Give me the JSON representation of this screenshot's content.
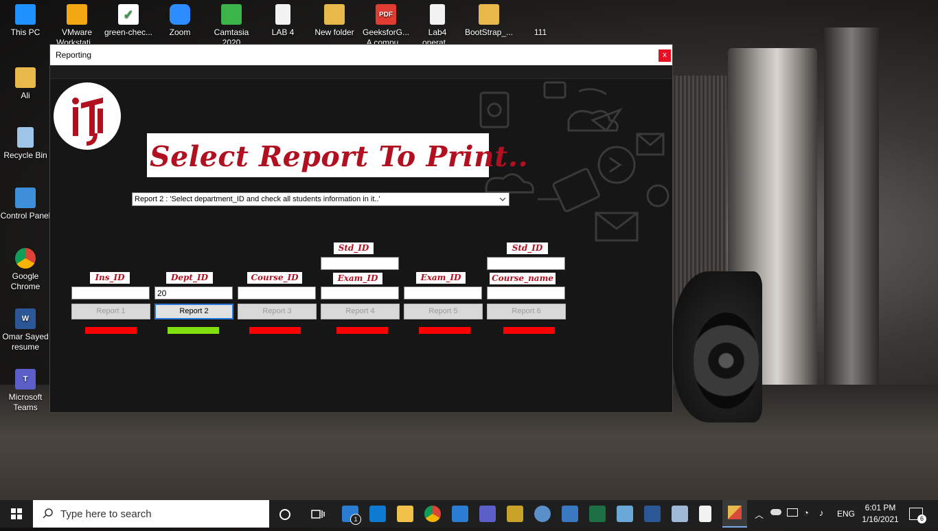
{
  "desktop": {
    "icons": [
      {
        "label": "This PC",
        "color": "#1e90ff"
      },
      {
        "label": "VMware Workstati...",
        "color": "#f3a712"
      },
      {
        "label": "green-chec...",
        "color": "#2ea043"
      },
      {
        "label": "Zoom",
        "color": "#2d8cff"
      },
      {
        "label": "Camtasia 2020",
        "color": "#3bb54a"
      },
      {
        "label": "LAB 4",
        "color": "#e8e8e8"
      },
      {
        "label": "New folder",
        "color": "#e8b84a"
      },
      {
        "label": "GeeksforG... A compu...",
        "color": "#e03c31"
      },
      {
        "label": "Lab4 operat...",
        "color": "#e8e8e8"
      },
      {
        "label": "BootStrap_...",
        "color": "#e8b84a"
      },
      {
        "label": "111",
        "color": "#3a3a3a"
      },
      {
        "label": "Ali",
        "color": "#e8b84a"
      },
      {
        "label": "Recycle Bin",
        "color": "#9ec5e8"
      },
      {
        "label": "Control Panel",
        "color": "#3c8fd8"
      },
      {
        "label": "Google Chrome",
        "color": "#db4437"
      },
      {
        "label": "Omar Sayed resume",
        "color": "#2b5797"
      },
      {
        "label": "Microsoft Teams",
        "color": "#5b5fc7"
      }
    ],
    "icon_glyphs": {
      "pdf_badge": "PDF",
      "word_badge": "W",
      "teams_badge": "T"
    }
  },
  "window": {
    "title": "Reporting",
    "close_label": "x",
    "heading": "Select Report To Print..",
    "combo_value": "Report 2 : 'Select department_ID and check all students information in it..'",
    "top_labels": [
      "Std_ID",
      "Std_ID"
    ],
    "params": [
      {
        "label": "Ins_ID",
        "value": "",
        "button": "Report 1",
        "status": "#ff0000",
        "active": false
      },
      {
        "label": "Dept_ID",
        "value": "20",
        "button": "Report 2",
        "status": "#80e010",
        "active": true
      },
      {
        "label": "Course_ID",
        "value": "",
        "button": "Report 3",
        "status": "#ff0000",
        "active": false
      },
      {
        "label": "Exam_ID",
        "value": "",
        "button": "Report 4",
        "status": "#ff0000",
        "active": false
      },
      {
        "label": "Exam_ID",
        "value": "",
        "button": "Report 5",
        "status": "#ff0000",
        "active": false
      },
      {
        "label": "Course_name",
        "value": "",
        "button": "Report 6",
        "status": "#ff0000",
        "active": false
      }
    ]
  },
  "taskbar": {
    "search_placeholder": "Type here to search",
    "language": "ENG",
    "time": "6:01 PM",
    "date": "1/16/2021",
    "notification_count": "6",
    "mail_badge": "1",
    "pinned": [
      "task-view",
      "mail",
      "vscode",
      "file-explorer",
      "chrome",
      "app-generic",
      "teams",
      "tools",
      "settings",
      "photos",
      "excel",
      "app-blue",
      "word",
      "remote-desktop",
      "notepad",
      "winforms-app"
    ]
  },
  "colors": {
    "accent_red": "#b01020",
    "status_red": "#ff0000",
    "status_green": "#80e010",
    "focus_blue": "#2a79d8"
  }
}
